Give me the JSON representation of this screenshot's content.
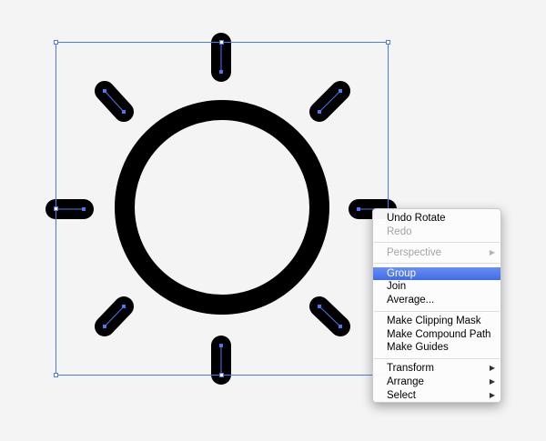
{
  "colors": {
    "canvas_background": "#f4f4f4",
    "artwork": "#000000",
    "selection_accent": "#4f78f0",
    "menu_highlight": "#3f6be8",
    "menu_disabled_text": "#a3a3a3"
  },
  "artwork": {
    "icon": "sun-icon",
    "ray_count": 8
  },
  "context_menu": {
    "submenu_arrow_icon": "triangle-right-icon",
    "items": {
      "undo_rotate": "Undo Rotate",
      "redo": "Redo",
      "perspective": "Perspective",
      "group": "Group",
      "join": "Join",
      "average": "Average...",
      "make_clipping_mask": "Make Clipping Mask",
      "make_compound_path": "Make Compound Path",
      "make_guides": "Make Guides",
      "transform": "Transform",
      "arrange": "Arrange",
      "select": "Select"
    },
    "disabled": [
      "redo",
      "perspective"
    ],
    "highlighted": "group",
    "arrow_glyph": "▶"
  }
}
